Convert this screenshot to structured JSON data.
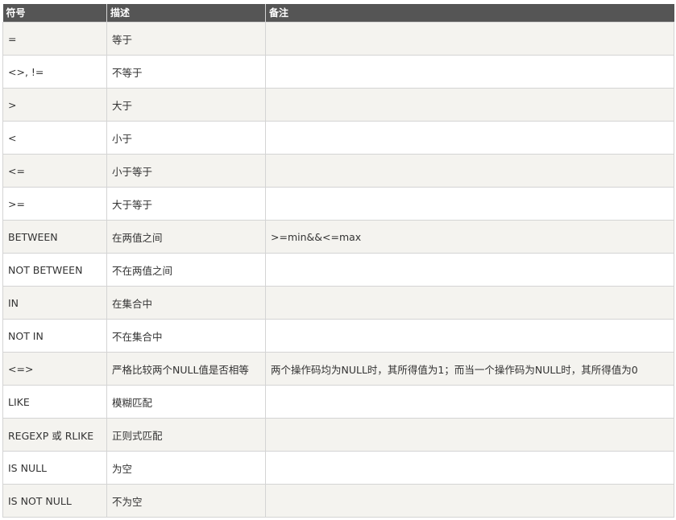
{
  "table": {
    "headers": [
      "符号",
      "描述",
      "备注"
    ],
    "rows": [
      [
        "=",
        "等于",
        ""
      ],
      [
        "<>, !=",
        "不等于",
        ""
      ],
      [
        ">",
        "大于",
        ""
      ],
      [
        "<",
        "小于",
        ""
      ],
      [
        "<=",
        "小于等于",
        ""
      ],
      [
        ">=",
        "大于等于",
        ""
      ],
      [
        "BETWEEN",
        "在两值之间",
        ">=min&&<=max"
      ],
      [
        "NOT BETWEEN",
        "不在两值之间",
        ""
      ],
      [
        "IN",
        "在集合中",
        ""
      ],
      [
        "NOT IN",
        "不在集合中",
        ""
      ],
      [
        "<=>",
        "严格比较两个NULL值是否相等",
        "两个操作码均为NULL时，其所得值为1；而当一个操作码为NULL时，其所得值为0"
      ],
      [
        "LIKE",
        "模糊匹配",
        ""
      ],
      [
        "REGEXP 或 RLIKE",
        "正则式匹配",
        ""
      ],
      [
        "IS NULL",
        "为空",
        ""
      ],
      [
        "IS NOT NULL",
        "不为空",
        ""
      ]
    ]
  }
}
